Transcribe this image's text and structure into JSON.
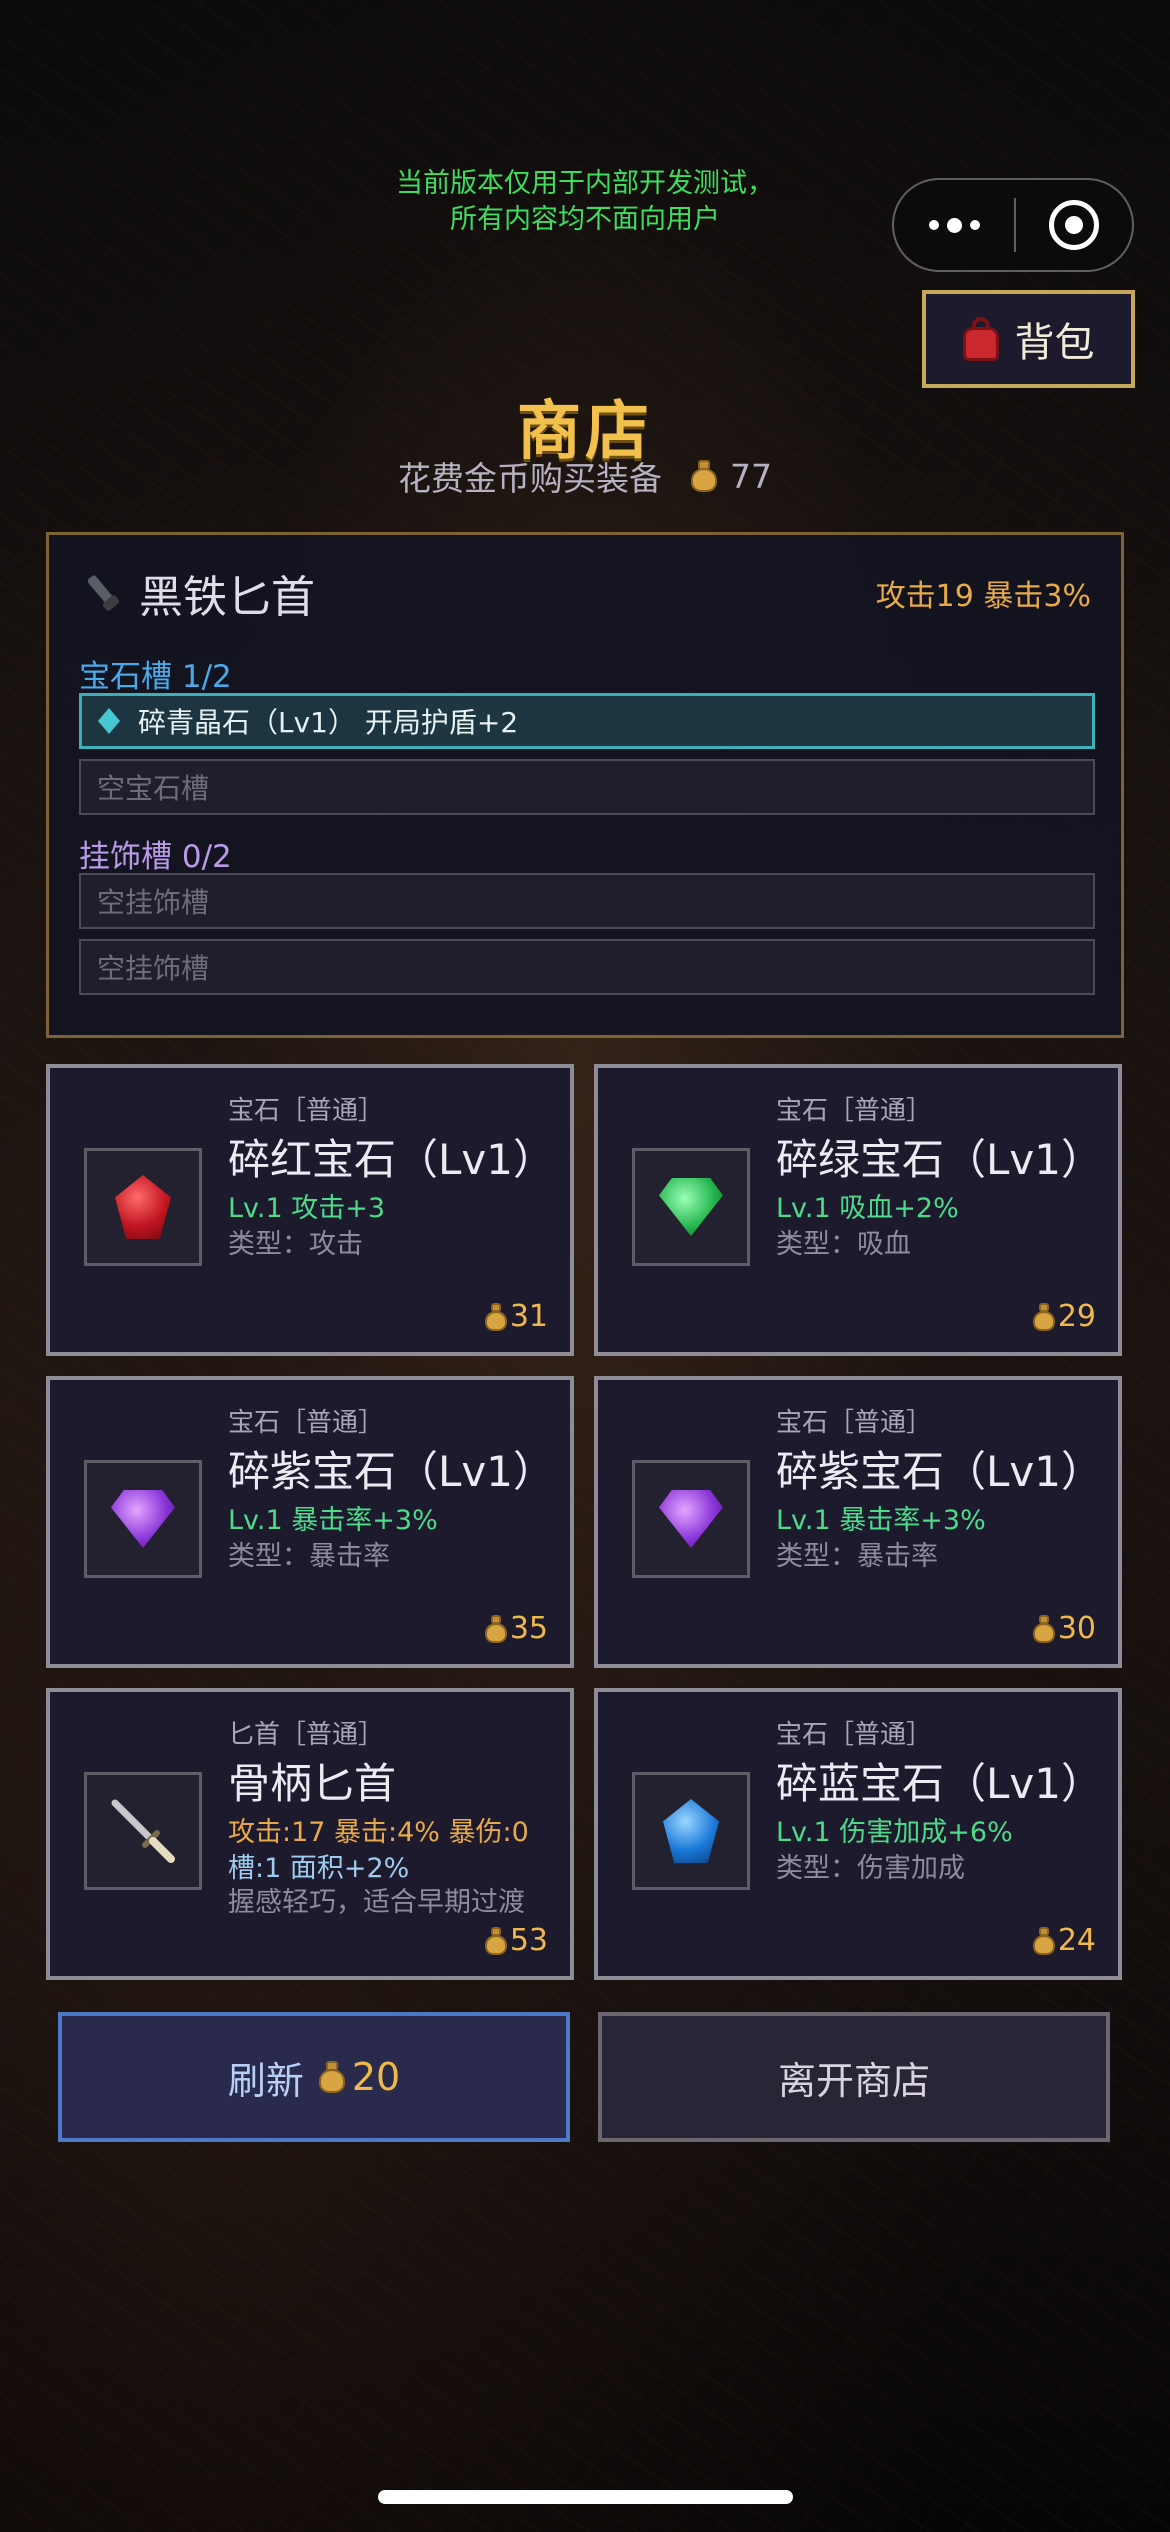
{
  "dev_notice": [
    "当前版本仅用于内部开发测试，",
    "所有内容均不面向用户"
  ],
  "bag_button": {
    "label": "背包",
    "icon": "backpack-icon"
  },
  "header": {
    "title": "商店",
    "subtitle": "花费金币购买装备",
    "gold": "77"
  },
  "equipment": {
    "name": "黑铁匕首",
    "stats": "攻击19 暴击3%",
    "gem_slots_label": "宝石槽 1/2",
    "gem_slots": [
      {
        "text": "碎青晶石（Lv1） 开局护盾+2",
        "filled": true
      },
      {
        "text": "空宝石槽",
        "filled": false
      }
    ],
    "ornament_slots_label": "挂饰槽 0/2",
    "ornament_slots": [
      {
        "text": "空挂饰槽"
      },
      {
        "text": "空挂饰槽"
      }
    ]
  },
  "shop_items": [
    {
      "category": "宝石［普通］",
      "name": "碎红宝石（Lv1）",
      "line1": "Lv.1 攻击+3",
      "line2": "类型：攻击",
      "price": "31",
      "color": "#d0202c"
    },
    {
      "category": "宝石［普通］",
      "name": "碎绿宝石（Lv1）",
      "line1": "Lv.1 吸血+2%",
      "line2": "类型：吸血",
      "price": "29",
      "color": "#2fc85a"
    },
    {
      "category": "宝石［普通］",
      "name": "碎紫宝石（Lv1）",
      "line1": "Lv.1 暴击率+3%",
      "line2": "类型：暴击率",
      "price": "35",
      "color": "#8a3ad8"
    },
    {
      "category": "宝石［普通］",
      "name": "碎紫宝石（Lv1）",
      "line1": "Lv.1 暴击率+3%",
      "line2": "类型：暴击率",
      "price": "30",
      "color": "#8a3ad8"
    },
    {
      "category": "匕首［普通］",
      "name": "骨柄匕首",
      "line1": "攻击:17 暴击:4% 暴伤:0",
      "line2": "槽:1 面积+2%",
      "line3": "握感轻巧，适合早期过渡",
      "price": "53",
      "color": "#9a9a9a"
    },
    {
      "category": "宝石［普通］",
      "name": "碎蓝宝石（Lv1）",
      "line1": "Lv.1 伤害加成+6%",
      "line2": "类型：伤害加成",
      "price": "24",
      "color": "#1a78d8"
    }
  ],
  "buttons": {
    "refresh_label": "刷新",
    "refresh_cost": "20",
    "leave_label": "离开商店"
  }
}
